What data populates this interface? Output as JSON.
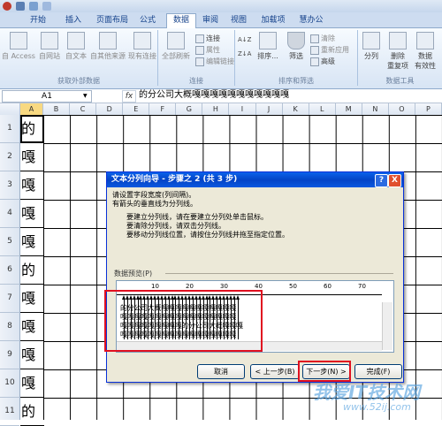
{
  "window": {
    "quick_access": [
      "save-icon",
      "undo-icon",
      "redo-icon"
    ]
  },
  "tabs": [
    {
      "label": "开始"
    },
    {
      "label": "插入"
    },
    {
      "label": "页面布局"
    },
    {
      "label": "公式"
    },
    {
      "label": "数据",
      "active": true
    },
    {
      "label": "审阅"
    },
    {
      "label": "视图"
    },
    {
      "label": "加载项"
    },
    {
      "label": "慧办公"
    }
  ],
  "ribbon": {
    "external": {
      "label": "获取外部数据",
      "buttons": [
        "自 Access",
        "自网站",
        "自文本",
        "自其他来源",
        "现有连接"
      ]
    },
    "connections": {
      "label": "连接",
      "refresh": "全部刷新",
      "items": [
        "连接",
        "属性",
        "编辑链接"
      ]
    },
    "sort": {
      "label": "排序和筛选",
      "sort": "排序...",
      "filter": "筛选",
      "items": [
        "清除",
        "重新应用",
        "高级"
      ]
    },
    "tools": {
      "label": "数据工具",
      "buttons": [
        "分列",
        "删除\n重复项",
        "数据\n有效性"
      ]
    }
  },
  "formula": {
    "name_box": "A1",
    "fx": "fx",
    "content": "的分公司大概嘎嘎嘎嘎嘎嘎嘎嘎嘎嘎嘎"
  },
  "grid": {
    "columns": [
      "A",
      "B",
      "C",
      "D",
      "E",
      "F",
      "G",
      "H",
      "I",
      "J",
      "K",
      "L",
      "M",
      "N",
      "O",
      "P"
    ],
    "rows": [
      "1",
      "2",
      "3",
      "4",
      "5",
      "6",
      "7",
      "8",
      "9",
      "10",
      "11"
    ],
    "col_a": [
      "的",
      "嘎",
      "嘎",
      "嘎",
      "嘎",
      "的",
      "嘎",
      "嘎",
      "嘎",
      "嘎",
      "的"
    ]
  },
  "dialog": {
    "title": "文本分列向导 - 步骤之 2 (共 3 步)",
    "help": "?",
    "close": "X",
    "line1": "请设置字段宽度(列间隔)。",
    "line2": "有箭头的垂直线为分列线。",
    "inst1": "要建立分列线，请在要建立分列处单击鼠标。",
    "inst2": "要清除分列线，请双击分列线。",
    "inst3": "要移动分列线位置，请按住分列线并拖至指定位置。",
    "preview_label": "数据预览(P)",
    "ruler": [
      "10",
      "20",
      "30",
      "40",
      "50",
      "60",
      "70"
    ],
    "preview_rows": [
      "的分公司大概嘎嘎嘎嘎嘎嘎嘎嘎嘎嘎嘎",
      "嘎嘎嘎嘎嘎嘎嘎嘎嘎嘎嘎嘎嘎嘎嘎嘎嘎",
      "嘎嘎嘎嘎嘎嘎嘎嘎嘎的分公司大概嘎嘎嘎",
      "嘎嘎嘎嘎嘎嘎嘎嘎嘎嘎嘎嘎嘎嘎嘎嘎嘎"
    ],
    "buttons": {
      "cancel": "取消",
      "back": "< 上一步(B)",
      "next": "下一步(N) >",
      "finish": "完成(F)"
    }
  },
  "watermark": {
    "line1": "我爱IT技术网",
    "line2": "www.52ij.com"
  }
}
